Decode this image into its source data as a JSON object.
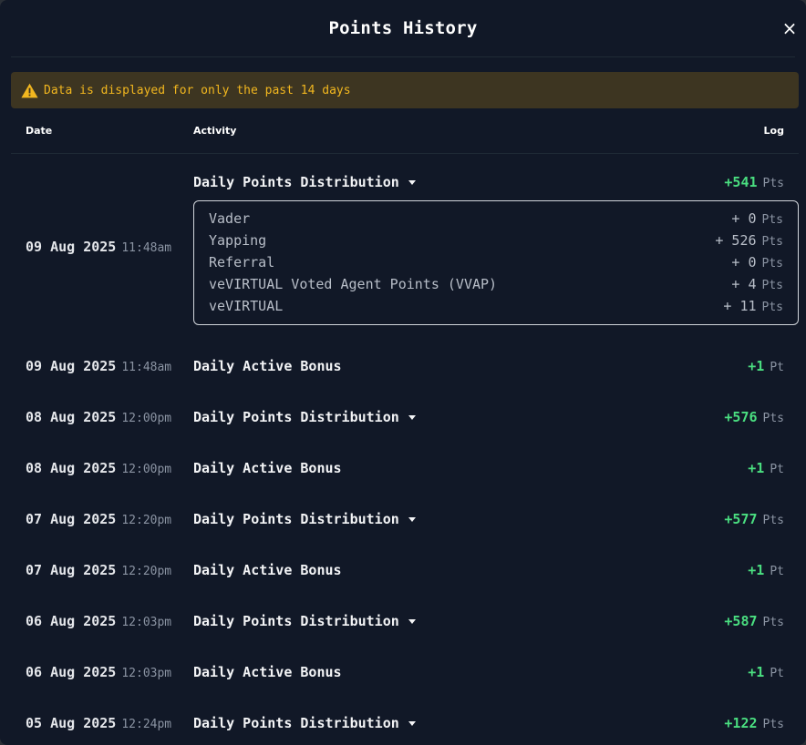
{
  "modal": {
    "title": "Points History",
    "close_label": "×"
  },
  "warning": {
    "text": "Data is displayed for only the past 14 days"
  },
  "columns": {
    "date": "Date",
    "activity": "Activity",
    "log": "Log"
  },
  "rows": [
    {
      "date": "09 Aug 2025",
      "time": "11:48am",
      "activity": "Daily Points Distribution",
      "value": "+541",
      "unit": "Pts",
      "expandable": true
    },
    {
      "date": "09 Aug 2025",
      "time": "11:48am",
      "activity": "Daily Active Bonus",
      "value": "+1",
      "unit": "Pt",
      "expandable": false
    },
    {
      "date": "08 Aug 2025",
      "time": "12:00pm",
      "activity": "Daily Points Distribution",
      "value": "+576",
      "unit": "Pts",
      "expandable": true
    },
    {
      "date": "08 Aug 2025",
      "time": "12:00pm",
      "activity": "Daily Active Bonus",
      "value": "+1",
      "unit": "Pt",
      "expandable": false
    },
    {
      "date": "07 Aug 2025",
      "time": "12:20pm",
      "activity": "Daily Points Distribution",
      "value": "+577",
      "unit": "Pts",
      "expandable": true
    },
    {
      "date": "07 Aug 2025",
      "time": "12:20pm",
      "activity": "Daily Active Bonus",
      "value": "+1",
      "unit": "Pt",
      "expandable": false
    },
    {
      "date": "06 Aug 2025",
      "time": "12:03pm",
      "activity": "Daily Points Distribution",
      "value": "+587",
      "unit": "Pts",
      "expandable": true
    },
    {
      "date": "06 Aug 2025",
      "time": "12:03pm",
      "activity": "Daily Active Bonus",
      "value": "+1",
      "unit": "Pt",
      "expandable": false
    },
    {
      "date": "05 Aug 2025",
      "time": "12:24pm",
      "activity": "Daily Points Distribution",
      "value": "+122",
      "unit": "Pts",
      "expandable": true
    }
  ],
  "breakdown": [
    {
      "label": "Vader",
      "value": "+ 0",
      "unit": "Pts"
    },
    {
      "label": "Yapping",
      "value": "+ 526",
      "unit": "Pts"
    },
    {
      "label": "Referral",
      "value": "+ 0",
      "unit": "Pts"
    },
    {
      "label": "veVIRTUAL Voted Agent Points (VVAP)",
      "value": "+ 4",
      "unit": "Pts"
    },
    {
      "label": "veVIRTUAL",
      "value": "+ 11",
      "unit": "Pts"
    }
  ],
  "colors": {
    "background": "#111827",
    "positive": "#4ade80",
    "warning_bg": "#3d3521",
    "warning_text": "#f2b71f"
  },
  "icons": {
    "warning": "warning-triangle-icon",
    "close": "close-icon",
    "expand": "caret-down-icon"
  }
}
